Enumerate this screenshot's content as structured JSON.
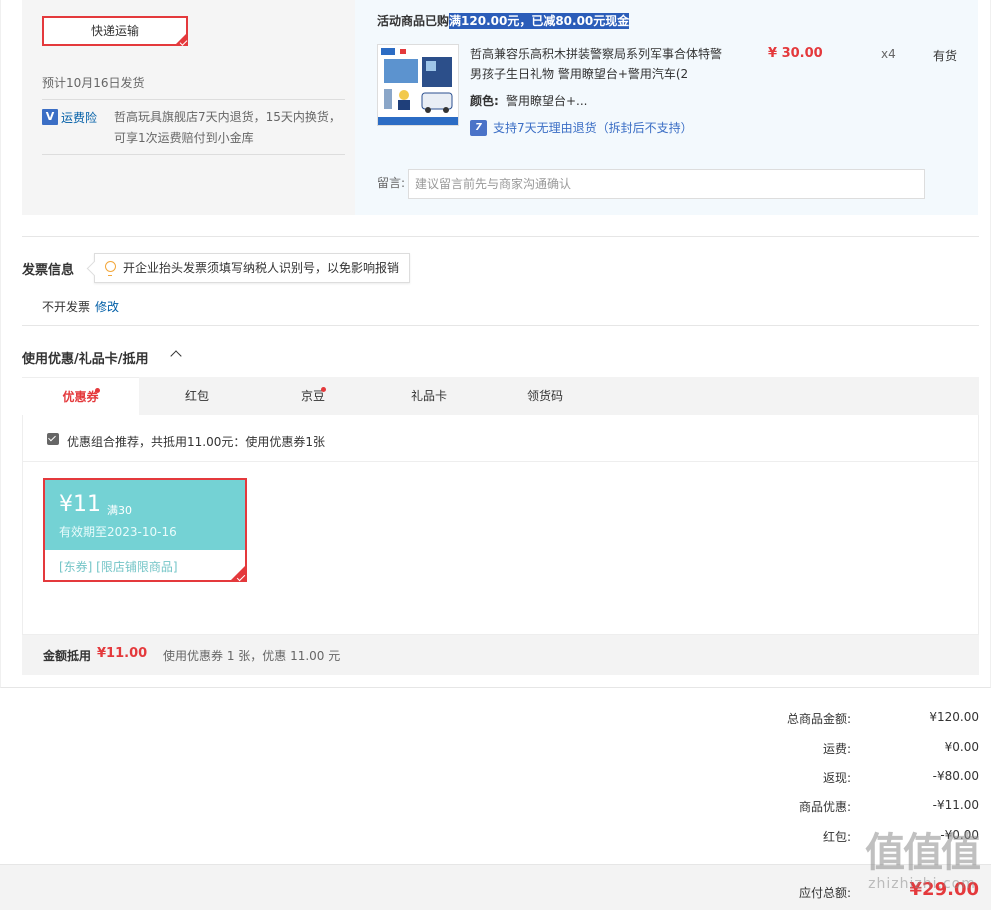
{
  "shipping": {
    "method_label": "快递运输",
    "date_text": "预计10月16日发货",
    "insurance_icon": "shield-v-icon",
    "insurance_label": "运费险",
    "insurance_desc": "哲高玩具旗舰店7天内退货，15天内换货，可享1次运费赔付到小金库"
  },
  "promo": {
    "prefix": "活动商品已购",
    "highlight": "满120.00元，已减80.00元现金"
  },
  "product": {
    "title": "哲高兼容乐高积木拼装警察局系列军事合体特警男孩子生日礼物 警用瞭望台+警用汽车(2",
    "price": "¥ 30.00",
    "qty": "x4",
    "stock": "有货",
    "color_label": "颜色:",
    "color_value": "警用瞭望台+...",
    "return_icon": "seven-day-return-icon",
    "return_text": "支持7天无理由退货（拆封后不支持）"
  },
  "memo": {
    "label": "留言:",
    "placeholder": "建议留言前先与商家沟通确认"
  },
  "invoice": {
    "title": "发票信息",
    "tip": "开企业抬头发票须填写纳税人识别号，以免影响报销",
    "status": "不开发票",
    "edit_label": "修改"
  },
  "coupons": {
    "title": "使用优惠/礼品卡/抵用",
    "tabs": [
      {
        "label": "优惠券",
        "dot": true,
        "active": true
      },
      {
        "label": "红包",
        "dot": false,
        "active": false
      },
      {
        "label": "京豆",
        "dot": true,
        "active": false
      },
      {
        "label": "礼品卡",
        "dot": false,
        "active": false
      },
      {
        "label": "领货码",
        "dot": false,
        "active": false
      }
    ],
    "recommend_text": "优惠组合推荐，共抵用11.00元：使用优惠券1张",
    "card": {
      "amount": "¥11",
      "condition": "满30",
      "valid": "有效期至2023-10-16",
      "tags": "[东券]  [限店铺限商品]"
    },
    "summary_label": "金额抵用",
    "summary_amount": "¥11.00",
    "summary_desc": "使用优惠券 1 张，优惠 11.00 元"
  },
  "totals": [
    {
      "label": "总商品金额:",
      "value": "¥120.00"
    },
    {
      "label": "运费:",
      "value": "¥0.00"
    },
    {
      "label": "返现:",
      "value": "-¥80.00"
    },
    {
      "label": "商品优惠:",
      "value": "-¥11.00"
    },
    {
      "label": "红包:",
      "value": "-¥0.00"
    }
  ],
  "payable": {
    "label": "应付总额:",
    "value": "¥29.00"
  },
  "watermark": {
    "logo": "值值值",
    "url": "zhizhizhi.com"
  },
  "colors": {
    "accent_red": "#e4393c",
    "link_blue": "#005ea7",
    "coupon_teal": "#74d2d4"
  }
}
